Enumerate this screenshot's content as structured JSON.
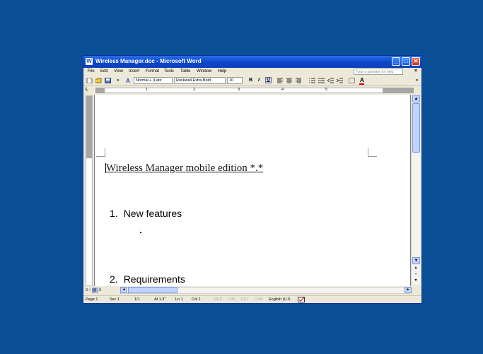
{
  "window": {
    "title": "Wireless Manager.doc - Microsoft Word",
    "app_icon": "W",
    "buttons": {
      "minimize": "_",
      "maximize": "□",
      "close": "✕"
    }
  },
  "menu": {
    "items": [
      "File",
      "Edit",
      "View",
      "Insert",
      "Format",
      "Tools",
      "Table",
      "Window",
      "Help"
    ],
    "help_placeholder": "Type a question for help",
    "close_doc": "×"
  },
  "toolbar": {
    "overflow": "»",
    "style_value": "Normal + (Latir",
    "font_value": "Rockwell Extra Bold",
    "size_value": "10",
    "bold": "B",
    "italic": "I",
    "underline": "U",
    "font_color": "A"
  },
  "ruler": {
    "numbers": [
      "1",
      "2",
      "3",
      "4",
      "5"
    ],
    "corner": "L"
  },
  "document": {
    "title": "Wireless Manager mobile edition *.*",
    "headings": [
      {
        "num": "1.",
        "text": "New features"
      },
      {
        "num": "2.",
        "text": "Requirements"
      }
    ]
  },
  "views": {
    "page_num": "3"
  },
  "status": {
    "page": "Page 1",
    "sec": "Sec 1",
    "pages": "1/1",
    "at": "At 1.3\"",
    "ln": "Ln 1",
    "col": "Col 1",
    "rec": "REC",
    "trk": "TRK",
    "ext": "EXT",
    "ovr": "OVR",
    "language": "English (U.S"
  },
  "colors": {
    "desktop": "#0a4f96",
    "titlebar": "#0c49cc",
    "chrome": "#ece9d8"
  }
}
